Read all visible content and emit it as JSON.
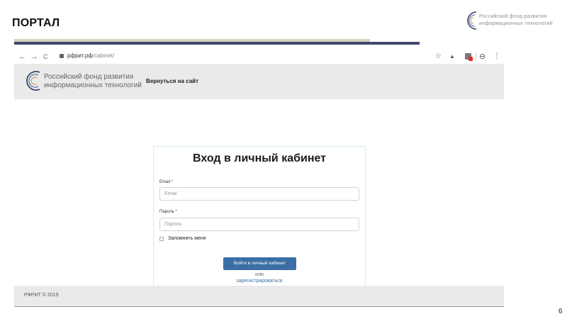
{
  "slide": {
    "title": "ПОРТАЛ",
    "number": "6",
    "logo_text_line1": "Российский фонд развития",
    "logo_text_line2": "информационных технологий"
  },
  "browser": {
    "nav": {
      "back": "←",
      "forward": "→",
      "reload": "C"
    },
    "url_domain": "рфрит.рф",
    "url_path": "/cabinet/",
    "toolbar": {
      "star": "☆",
      "profile": "⊖",
      "menu": "⋮"
    }
  },
  "site": {
    "header": {
      "logo_line1": "Российский фонд развития",
      "logo_line2": "информационных технологий",
      "back_link": "Вернуться на сайт"
    },
    "login": {
      "title": "Вход в личный кабинет",
      "email_label": "Email",
      "email_placeholder": "Email",
      "password_label": "Пароль",
      "password_placeholder": "Пароль",
      "required_mark": "*",
      "remember_label": "Запомнить меня",
      "submit_label": "Войти в личный кабинет",
      "or_text": "или",
      "register_link": "зарегистрироваться"
    },
    "footer": {
      "copyright": "РФРИТ © 2019"
    }
  },
  "colors": {
    "accent_navy": "#3e4a6b",
    "accent_tan": "#d9cfc0",
    "button_blue": "#3b6ea6",
    "card_border": "#d3ecef"
  }
}
